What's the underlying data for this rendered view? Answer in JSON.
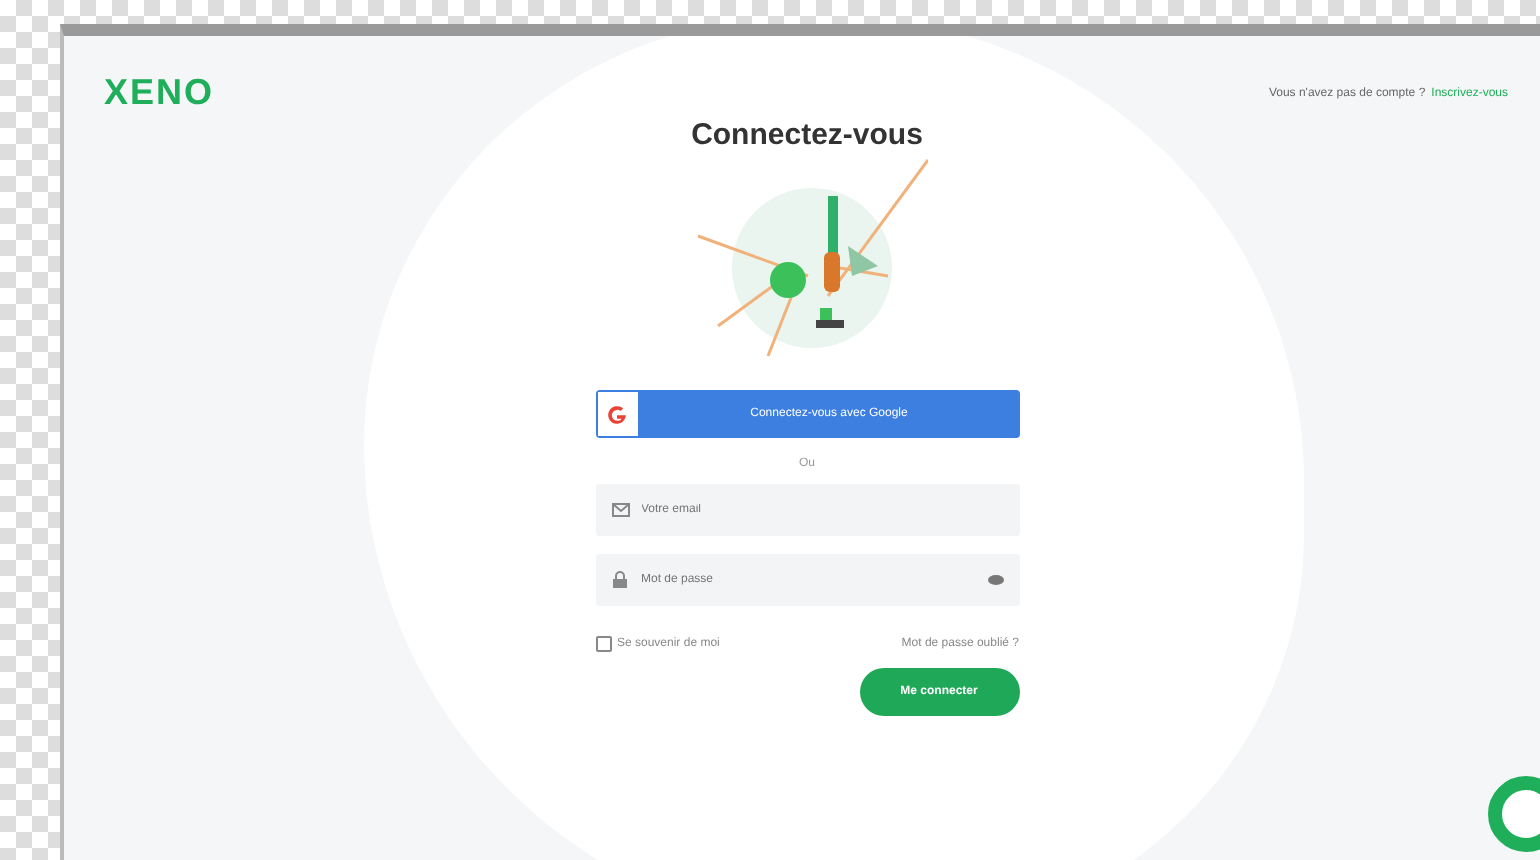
{
  "header": {
    "logo": "XENO",
    "signup_prompt": "Vous n'avez pas de compte ?",
    "signup_link": "Inscrivez-vous"
  },
  "form": {
    "title": "Connectez-vous",
    "google_button": "Connectez-vous avec Google",
    "separator": "Ou",
    "fields": [
      {
        "kind": "email",
        "placeholder": "Votre email"
      },
      {
        "kind": "password",
        "placeholder": "Mot de passe"
      }
    ],
    "remember": {
      "label": "Se souvenir de moi",
      "checked": false
    },
    "forgot_link": "Mot de passe oublié ?",
    "submit": "Me connecter"
  }
}
